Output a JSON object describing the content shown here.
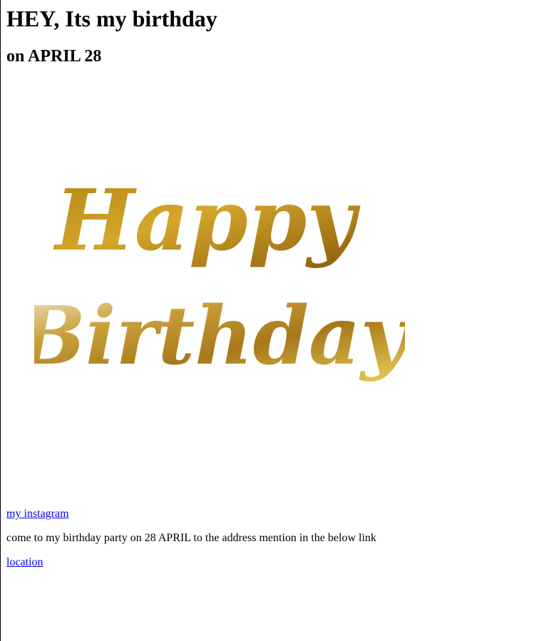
{
  "header": {
    "title": "HEY, Its my birthday",
    "subtitle": "on APRIL 28"
  },
  "image": {
    "line1": "Happy",
    "line2": "Birthday",
    "gold_dark": "#9a6a0e",
    "gold_mid": "#c9951f",
    "gold_light": "#e8d25a"
  },
  "links": {
    "instagram": "my instagram",
    "location": "location"
  },
  "body": {
    "message": "come to my birthday party on 28 APRIL to the address mention in the below link"
  }
}
